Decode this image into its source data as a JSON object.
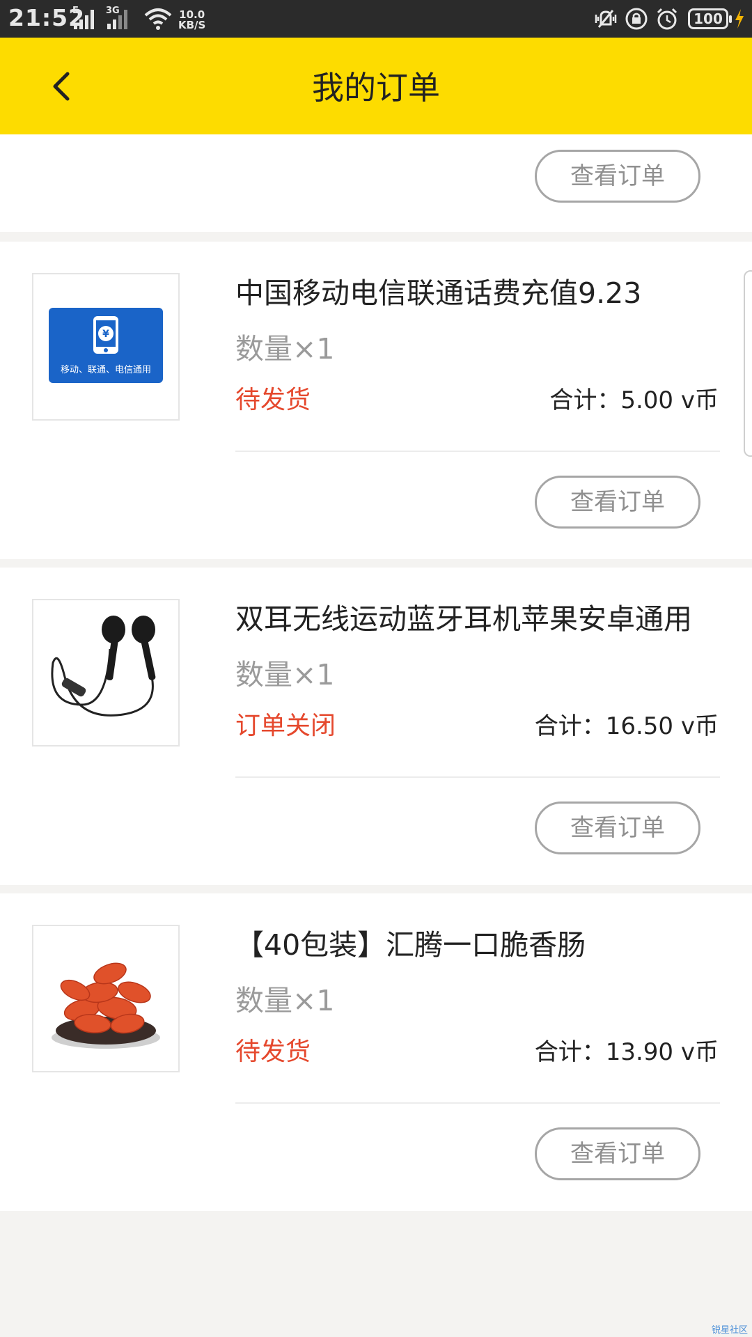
{
  "status_bar": {
    "time": "21:52",
    "network_type_1": "E",
    "network_type_2": "3G",
    "speed_value": "10.0",
    "speed_unit": "KB/S",
    "battery": "100"
  },
  "header": {
    "title": "我的订单",
    "back_icon": "chevron-left-icon",
    "background_color": "#fddc00"
  },
  "partial_card": {
    "view_button": "查看订单"
  },
  "orders": [
    {
      "name": "中国移动电信联通话费充值9.23",
      "quantity": "数量×1",
      "status": "待发货",
      "total": "合计：5.00 v币",
      "view_button": "查看订单",
      "image_caption": "移动、联通、电信通用",
      "image_icon": "phone-yuan-icon"
    },
    {
      "name": "双耳无线运动蓝牙耳机苹果安卓通用",
      "quantity": "数量×1",
      "status": "订单关闭",
      "total": "合计：16.50 v币",
      "view_button": "查看订单",
      "image_icon": "earphones-icon"
    },
    {
      "name": "【40包装】汇腾一口脆香肠",
      "quantity": "数量×1",
      "status": "待发货",
      "total": "合计：13.90 v币",
      "view_button": "查看订单",
      "image_icon": "sausage-plate-icon"
    }
  ],
  "watermark": "锐星社区",
  "colors": {
    "status_red": "#e5482d",
    "page_background": "#f4f3f1"
  }
}
